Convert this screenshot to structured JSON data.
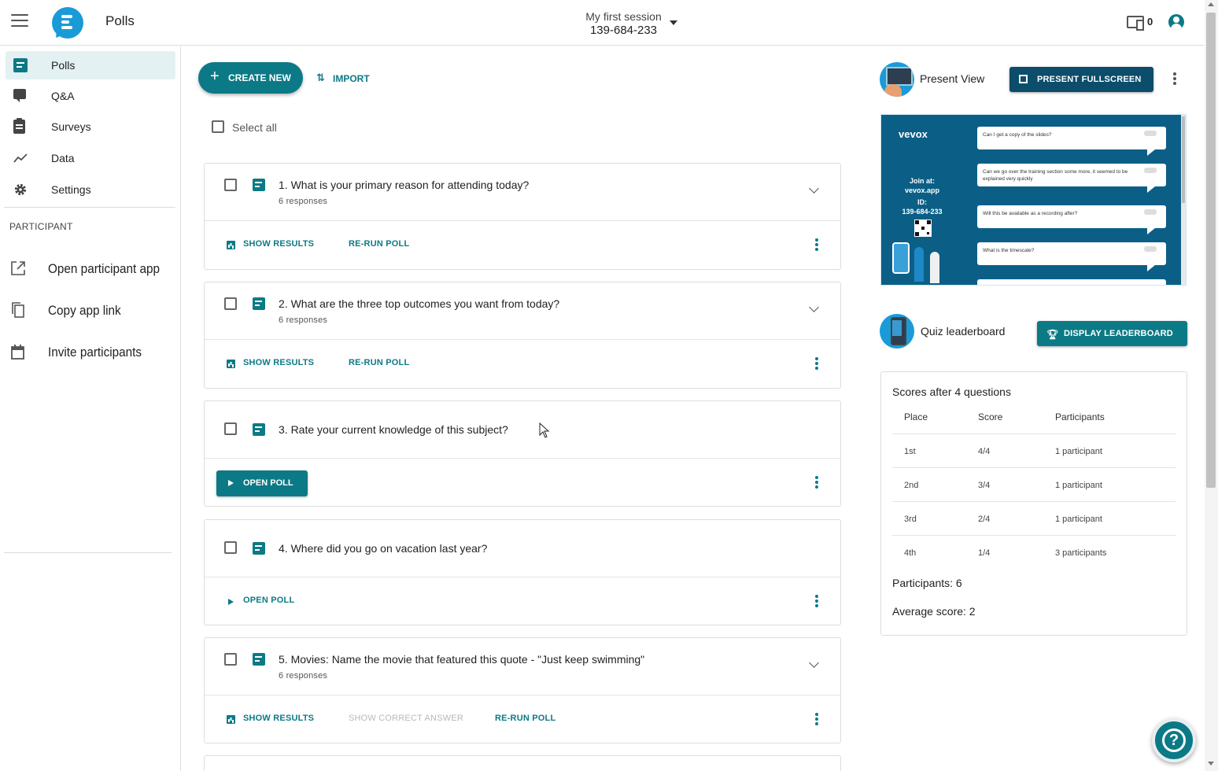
{
  "header": {
    "title": "Polls",
    "session_name": "My first session",
    "session_code": "139-684-233",
    "device_count": "0"
  },
  "sidebar": {
    "items": [
      {
        "label": "Polls",
        "icon": "poll-icon",
        "active": true
      },
      {
        "label": "Q&A",
        "icon": "forum-icon"
      },
      {
        "label": "Surveys",
        "icon": "clipboard-icon"
      },
      {
        "label": "Data",
        "icon": "trend-icon"
      },
      {
        "label": "Settings",
        "icon": "gear-icon"
      }
    ],
    "participant_section": "PARTICIPANT",
    "participant_items": [
      {
        "label": "Open participant app",
        "icon": "open-external-icon"
      },
      {
        "label": "Copy app link",
        "icon": "copy-icon"
      },
      {
        "label": "Invite participants",
        "icon": "calendar-icon"
      }
    ]
  },
  "toolbar": {
    "create_label": "CREATE NEW",
    "import_label": "IMPORT",
    "select_all_label": "Select all"
  },
  "polls": [
    {
      "question": "1. What is your primary reason for attending today?",
      "responses": "6 responses",
      "actions": [
        "SHOW RESULTS",
        "RE-RUN POLL"
      ]
    },
    {
      "question": "2. What are the three top outcomes you want from today?",
      "responses": "6 responses",
      "actions": [
        "SHOW RESULTS",
        "RE-RUN POLL"
      ]
    },
    {
      "question": "3. Rate your current knowledge of this subject?",
      "responses": "",
      "actions": [
        "OPEN POLL"
      ]
    },
    {
      "question": "4. Where did you go on vacation last year?",
      "responses": "",
      "actions": [
        "OPEN POLL"
      ]
    },
    {
      "question": "5. Movies: Name the movie that featured this quote - \"Just keep swimming\"",
      "responses": "6 responses",
      "actions": [
        "SHOW RESULTS",
        "SHOW CORRECT ANSWER",
        "RE-RUN POLL"
      ]
    }
  ],
  "present": {
    "title": "Present View",
    "fullscreen_label": "PRESENT FULLSCREEN",
    "preview": {
      "brand": "vevox",
      "join_label": "Join at:",
      "join_url": "vevox.app",
      "id_label": "ID:",
      "id_value": "139-684-233",
      "questions": [
        "Can I get a copy of the slides?",
        "Can we go over the training section some more, it seemed to be explained very quickly",
        "Will this be available as a recording after?",
        "What is the timescale?"
      ]
    }
  },
  "leaderboard": {
    "title": "Quiz leaderboard",
    "display_label": "DISPLAY LEADERBOARD",
    "heading": "Scores after 4 questions",
    "columns": [
      "Place",
      "Score",
      "Participants"
    ],
    "rows": [
      {
        "place": "1st",
        "score": "4/4",
        "participants": "1 participant"
      },
      {
        "place": "2nd",
        "score": "3/4",
        "participants": "1 participant"
      },
      {
        "place": "3rd",
        "score": "2/4",
        "participants": "1 participant"
      },
      {
        "place": "4th",
        "score": "1/4",
        "participants": "3 participants"
      }
    ],
    "participants_stat": "Participants: 6",
    "average_stat": "Average score: 2"
  },
  "help": {
    "label": "?"
  },
  "colors": {
    "primary": "#0c7a86",
    "dark": "#0b4d6b",
    "brand_blue": "#1a9bd7"
  }
}
